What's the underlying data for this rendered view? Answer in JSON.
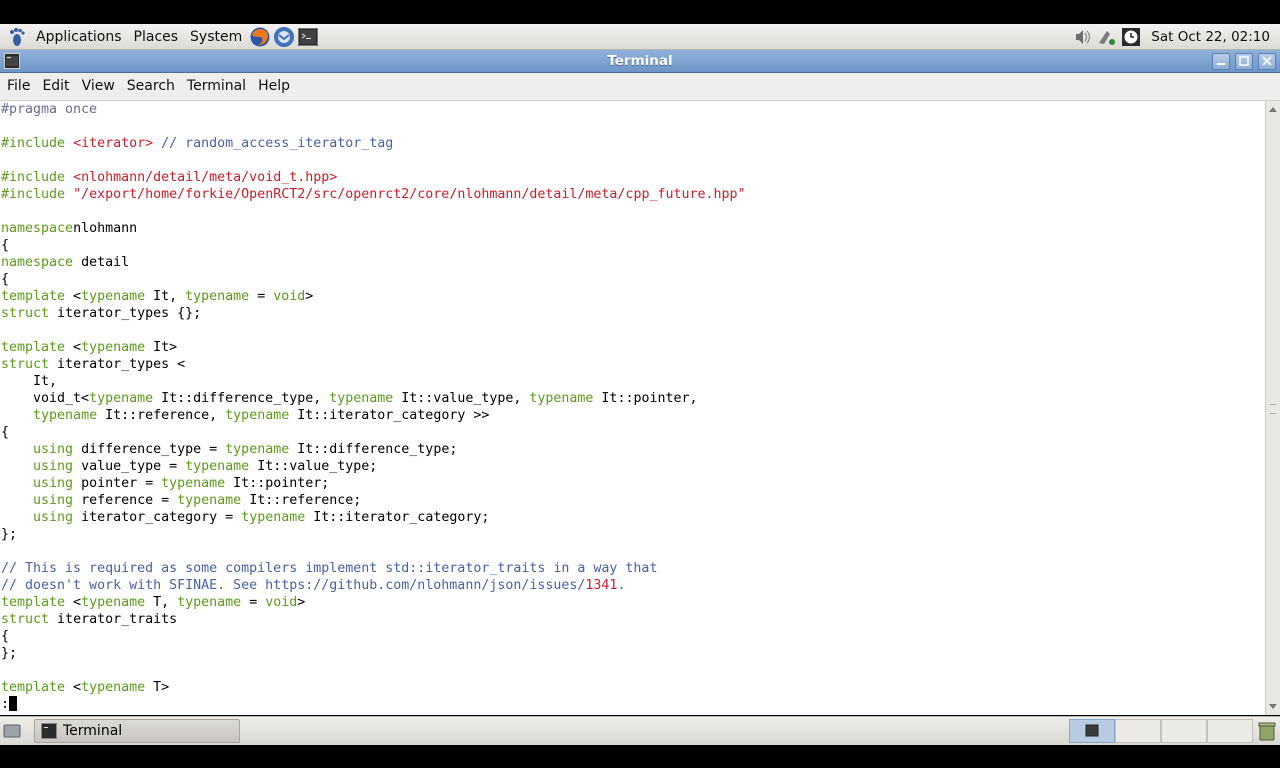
{
  "top_panel": {
    "menus": [
      "Applications",
      "Places",
      "System"
    ],
    "launchers": [
      "firefox-icon",
      "thunderbird-icon",
      "terminal-launcher-icon"
    ],
    "tray_icons": [
      "volume-icon",
      "network-icon",
      "clock-app-icon"
    ],
    "clock": "Sat Oct 22, 02:10"
  },
  "window": {
    "title": "Terminal",
    "menus": [
      "File",
      "Edit",
      "View",
      "Search",
      "Terminal",
      "Help"
    ]
  },
  "code_lines": [
    [
      [
        "pre",
        "#pragma once"
      ]
    ],
    [],
    [
      [
        "inc",
        "#include "
      ],
      [
        "str",
        "<iterator>"
      ],
      [
        "cmt",
        " // random_access_iterator_tag"
      ]
    ],
    [],
    [
      [
        "inc",
        "#include "
      ],
      [
        "str",
        "<nlohmann/detail/meta/void_t.hpp>"
      ]
    ],
    [
      [
        "inc",
        "#include "
      ],
      [
        "str",
        "\"/export/home/forkie/OpenRCT2/src/openrct2/core/nlohmann/detail/meta/cpp_future.hpp\""
      ]
    ],
    [],
    [
      [
        "kw",
        "namespace"
      ],
      [
        "",
        "nlohmann"
      ]
    ],
    [
      [
        "",
        "{"
      ]
    ],
    [
      [
        "kw",
        "namespace"
      ],
      [
        "",
        " detail"
      ]
    ],
    [
      [
        "",
        "{"
      ]
    ],
    [
      [
        "kw",
        "template"
      ],
      [
        "",
        " <"
      ],
      [
        "kw",
        "typename"
      ],
      [
        "",
        " It, "
      ],
      [
        "kw",
        "typename"
      ],
      [
        "",
        " = "
      ],
      [
        "kw",
        "void"
      ],
      [
        "",
        ">"
      ]
    ],
    [
      [
        "kw",
        "struct"
      ],
      [
        "",
        " iterator_types {};"
      ]
    ],
    [],
    [
      [
        "kw",
        "template"
      ],
      [
        "",
        " <"
      ],
      [
        "kw",
        "typename"
      ],
      [
        "",
        " It>"
      ]
    ],
    [
      [
        "kw",
        "struct"
      ],
      [
        "",
        " iterator_types <"
      ]
    ],
    [
      [
        "",
        "    It,"
      ]
    ],
    [
      [
        "",
        "    void_t<"
      ],
      [
        "kw",
        "typename"
      ],
      [
        "",
        " It::difference_type, "
      ],
      [
        "kw",
        "typename"
      ],
      [
        "",
        " It::value_type, "
      ],
      [
        "kw",
        "typename"
      ],
      [
        "",
        " It::pointer,"
      ]
    ],
    [
      [
        "",
        "    "
      ],
      [
        "kw",
        "typename"
      ],
      [
        "",
        " It::reference, "
      ],
      [
        "kw",
        "typename"
      ],
      [
        "",
        " It::iterator_category >>"
      ]
    ],
    [
      [
        "",
        "{"
      ]
    ],
    [
      [
        "",
        "    "
      ],
      [
        "kw",
        "using"
      ],
      [
        "",
        " difference_type = "
      ],
      [
        "kw",
        "typename"
      ],
      [
        "",
        " It::difference_type;"
      ]
    ],
    [
      [
        "",
        "    "
      ],
      [
        "kw",
        "using"
      ],
      [
        "",
        " value_type = "
      ],
      [
        "kw",
        "typename"
      ],
      [
        "",
        " It::value_type;"
      ]
    ],
    [
      [
        "",
        "    "
      ],
      [
        "kw",
        "using"
      ],
      [
        "",
        " pointer = "
      ],
      [
        "kw",
        "typename"
      ],
      [
        "",
        " It::pointer;"
      ]
    ],
    [
      [
        "",
        "    "
      ],
      [
        "kw",
        "using"
      ],
      [
        "",
        " reference = "
      ],
      [
        "kw",
        "typename"
      ],
      [
        "",
        " It::reference;"
      ]
    ],
    [
      [
        "",
        "    "
      ],
      [
        "kw",
        "using"
      ],
      [
        "",
        " iterator_category = "
      ],
      [
        "kw",
        "typename"
      ],
      [
        "",
        " It::iterator_category;"
      ]
    ],
    [
      [
        "",
        "};"
      ]
    ],
    [],
    [
      [
        "cmt",
        "// This is required as some compilers implement std::iterator_traits in a way that"
      ]
    ],
    [
      [
        "cmt",
        "// doesn't work with SFINAE. See https://github.com/nlohmann/json/issues/"
      ],
      [
        "num",
        "1341"
      ],
      [
        "cmt",
        "."
      ]
    ],
    [
      [
        "kw",
        "template"
      ],
      [
        "",
        " <"
      ],
      [
        "kw",
        "typename"
      ],
      [
        "",
        " T, "
      ],
      [
        "kw",
        "typename"
      ],
      [
        "",
        " = "
      ],
      [
        "kw",
        "void"
      ],
      [
        "",
        ">"
      ]
    ],
    [
      [
        "kw",
        "struct"
      ],
      [
        "",
        " iterator_traits"
      ]
    ],
    [
      [
        "",
        "{"
      ]
    ],
    [
      [
        "",
        "};"
      ]
    ],
    [],
    [
      [
        "kw",
        "template"
      ],
      [
        "",
        " <"
      ],
      [
        "kw",
        "typename"
      ],
      [
        "",
        " T>"
      ]
    ]
  ],
  "prompt": ":",
  "taskbar": {
    "window_button": "Terminal",
    "workspaces": 4
  }
}
